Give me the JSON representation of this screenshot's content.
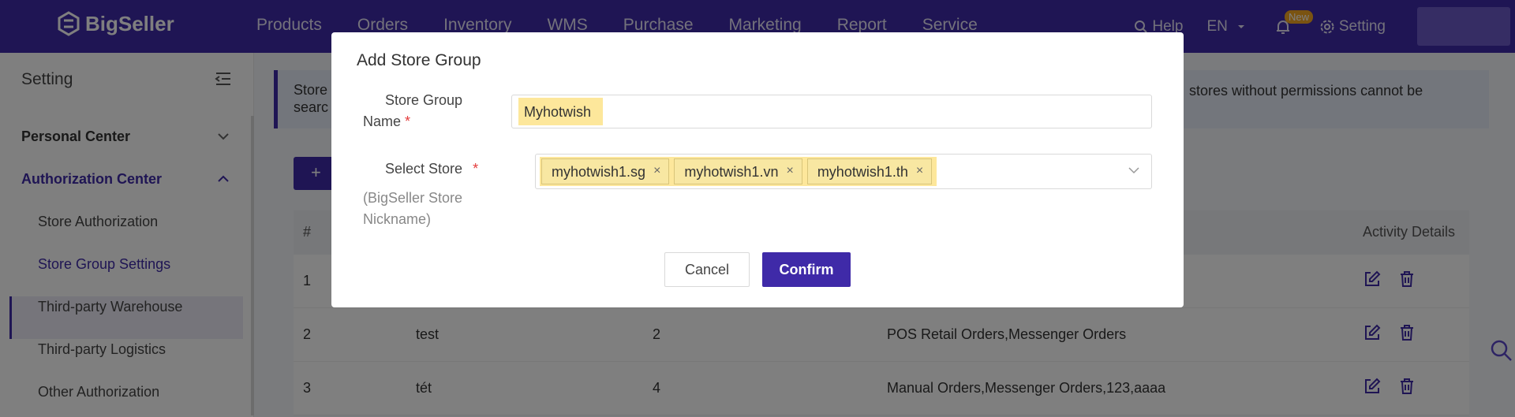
{
  "brand": {
    "name": "BigSeller",
    "accent": "#3f2aa8",
    "highlight": "#fde79b"
  },
  "topnav": {
    "menu": [
      "Products",
      "Orders",
      "Inventory",
      "WMS",
      "Purchase",
      "Marketing",
      "Report",
      "Service"
    ],
    "help": "Help",
    "lang": "EN",
    "notification_badge": "New",
    "setting": "Setting"
  },
  "sidebar": {
    "title": "Setting",
    "groups": [
      {
        "label": "Personal Center",
        "expanded": false
      },
      {
        "label": "Authorization Center",
        "expanded": true
      }
    ],
    "items": [
      "Store Authorization",
      "Store Group Settings",
      "Third-party Warehouse",
      "Third-party Logistics",
      "Other Authorization"
    ],
    "active_item": "Store Group Settings"
  },
  "main": {
    "notice_left": "Store\nsearc",
    "notice_right": "stores without permissions cannot be",
    "add_button": "+",
    "table": {
      "headers": {
        "index": "#",
        "activity": "Activity Details"
      },
      "rows": [
        {
          "index": "1",
          "name": "",
          "count": "",
          "orders": ""
        },
        {
          "index": "2",
          "name": "test",
          "count": "2",
          "orders": "POS Retail Orders,Messenger Orders"
        },
        {
          "index": "3",
          "name": "tét",
          "count": "4",
          "orders": "Manual Orders,Messenger Orders,123,aaaa"
        }
      ]
    }
  },
  "dialog": {
    "title": "Add Store Group",
    "name_label_1": "Store Group",
    "name_label_2": "Name",
    "required_mark": "*",
    "name_value": "Myhotwish",
    "store_label": "Select Store",
    "store_hint_1": "(BigSeller Store",
    "store_hint_2": "Nickname)",
    "selected_stores": [
      "myhotwish1.sg",
      "myhotwish1.vn",
      "myhotwish1.th"
    ],
    "tag_close": "×",
    "cancel": "Cancel",
    "confirm": "Confirm"
  }
}
